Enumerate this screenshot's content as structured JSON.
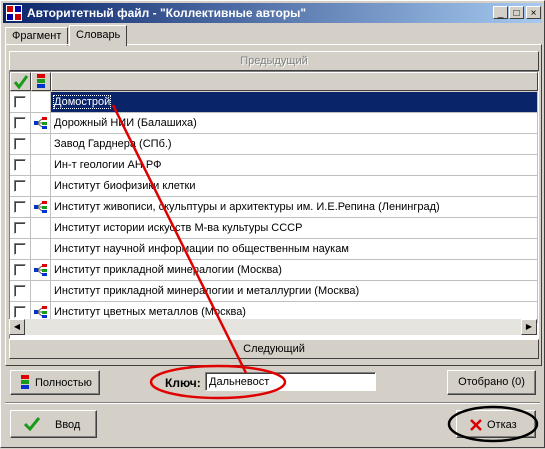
{
  "window": {
    "title": "Авторитетный файл - \"Коллективные авторы\"",
    "controls": [
      "_",
      "□",
      "×"
    ]
  },
  "tabs": [
    {
      "label": "Фрагмент",
      "active": false
    },
    {
      "label": "Словарь",
      "active": true
    }
  ],
  "nav": {
    "prev_label": "Предыдущий",
    "next_label": "Следующий"
  },
  "grid": {
    "header_icons": [
      "checkmark-icon",
      "stack-icon"
    ],
    "rows": [
      {
        "label": "Домострой",
        "has_tree_icon": false,
        "selected": true
      },
      {
        "label": "Дорожный НИИ (Балашиха)",
        "has_tree_icon": true,
        "selected": false
      },
      {
        "label": "Завод Гарднера (СПб.)",
        "has_tree_icon": false,
        "selected": false
      },
      {
        "label": "Ин-т геологии АН РФ",
        "has_tree_icon": false,
        "selected": false
      },
      {
        "label": "Институт биофизики клетки",
        "has_tree_icon": false,
        "selected": false
      },
      {
        "label": "Институт живописи, скульптуры и архитектуры им. И.Е.Репина (Ленинград)",
        "has_tree_icon": true,
        "selected": false
      },
      {
        "label": "Институт истории искусств М-ва культуры СССР",
        "has_tree_icon": false,
        "selected": false
      },
      {
        "label": "Институт научной информации по общественным наукам",
        "has_tree_icon": false,
        "selected": false
      },
      {
        "label": "Институт прикладной минералогии (Москва)",
        "has_tree_icon": true,
        "selected": false
      },
      {
        "label": "Институт прикладной минералогии и металлургии (Москва)",
        "has_tree_icon": false,
        "selected": false
      },
      {
        "label": "Институт цветных металлов (Москва)",
        "has_tree_icon": true,
        "selected": false
      }
    ]
  },
  "bottom": {
    "full_label": "Полностью",
    "key_label": "Ключ:",
    "key_value": "Дальневост",
    "selected_label": "Отобрано (0)",
    "ok_label": "Ввод",
    "cancel_label": "Отказ"
  },
  "colors": {
    "selection": "#0a246a",
    "annotation": "#e00000",
    "ok_check": "#1a9a1a"
  }
}
